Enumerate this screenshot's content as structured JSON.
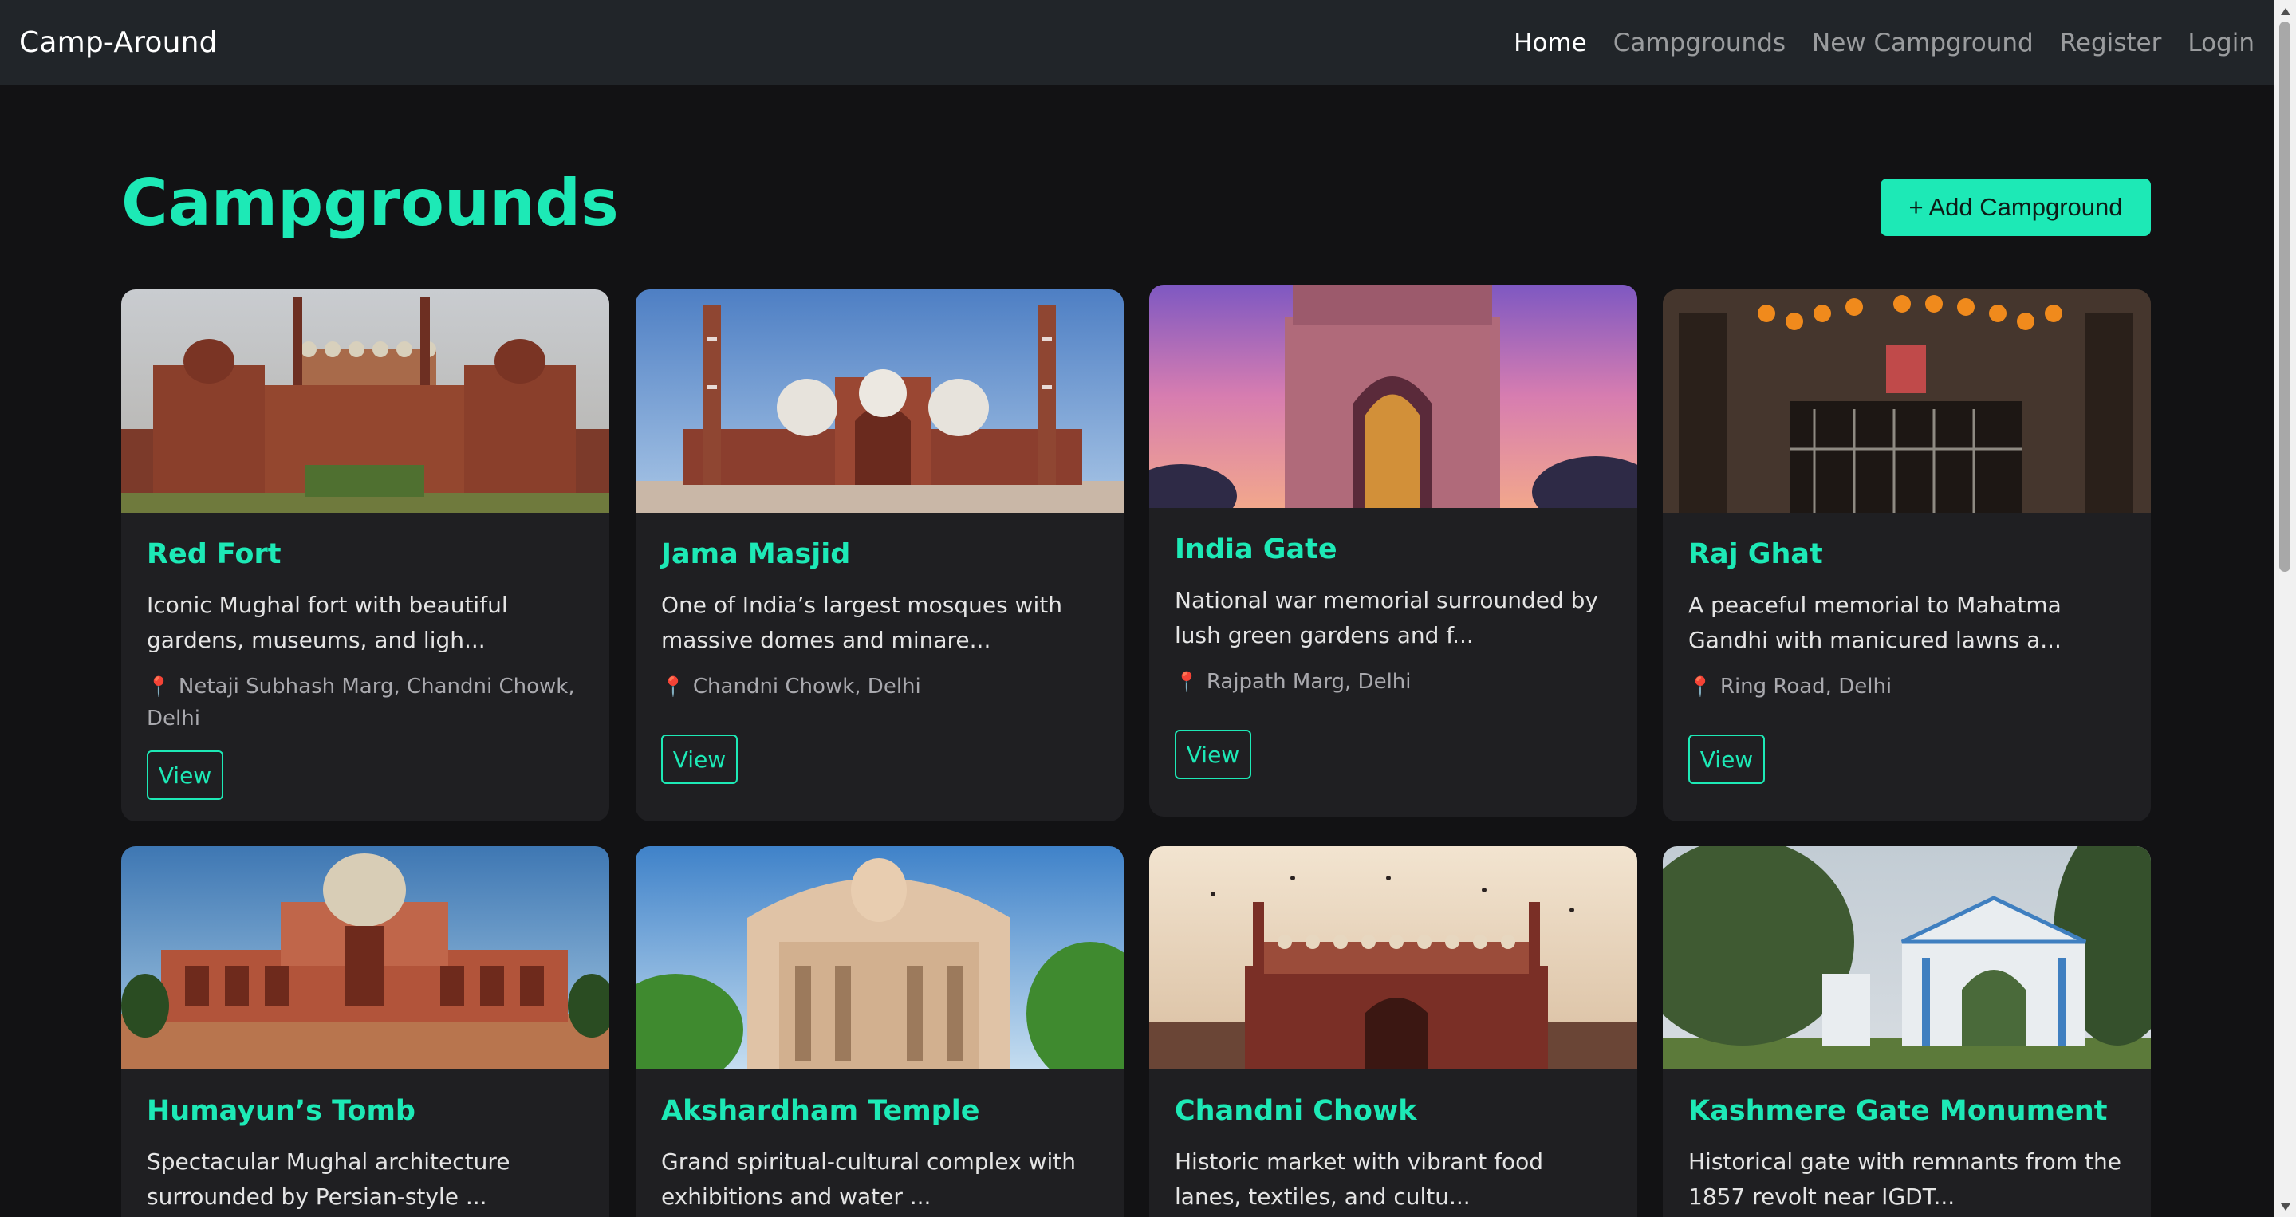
{
  "navbar": {
    "brand": "Camp-Around",
    "links": [
      {
        "label": "Home",
        "active": true
      },
      {
        "label": "Campgrounds",
        "active": false
      },
      {
        "label": "New Campground",
        "active": false
      },
      {
        "label": "Register",
        "active": false
      },
      {
        "label": "Login",
        "active": false
      }
    ]
  },
  "header": {
    "title": "Campgrounds",
    "add_button_label": "+ Add Campground"
  },
  "colors": {
    "accent": "#1de9b6",
    "background": "#121214",
    "card": "#1f1f22",
    "navbar": "#212529"
  },
  "pin_icon": "📍",
  "cards": [
    {
      "title": "Red Fort",
      "description": "Iconic Mughal fort with beautiful gardens, museums, and ligh...",
      "location": "Netaji Subhash Marg, Chandni Chowk, Delhi",
      "view_label": "View"
    },
    {
      "title": "Jama Masjid",
      "description": "One of India’s largest mosques with massive domes and minare...",
      "location": "Chandni Chowk, Delhi",
      "view_label": "View"
    },
    {
      "title": "India Gate",
      "description": "National war memorial surrounded by lush green gardens and f...",
      "location": "Rajpath Marg, Delhi",
      "view_label": "View"
    },
    {
      "title": "Raj Ghat",
      "description": "A peaceful memorial to Mahatma Gandhi with manicured lawns a...",
      "location": "Ring Road, Delhi",
      "view_label": "View"
    },
    {
      "title": "Humayun’s Tomb",
      "description": "Spectacular Mughal architecture surrounded by Persian-style ..."
    },
    {
      "title": "Akshardham Temple",
      "description": "Grand spiritual-cultural complex with exhibitions and water ..."
    },
    {
      "title": "Chandni Chowk",
      "description": "Historic market with vibrant food lanes, textiles, and cultu..."
    },
    {
      "title": "Kashmere Gate Monument",
      "description": "Historical gate with remnants from the 1857 revolt near IGDT..."
    }
  ]
}
